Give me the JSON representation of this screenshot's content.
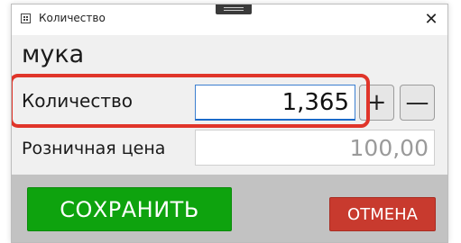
{
  "window": {
    "title": "Количество",
    "close_glyph": "✕",
    "app_icon": "calculator-icon"
  },
  "product": {
    "name": "мука"
  },
  "quantity": {
    "label": "Количество",
    "value": "1,365",
    "plus_label": "+",
    "minus_label": "—"
  },
  "price": {
    "label": "Розничная цена",
    "value": "100,00"
  },
  "actions": {
    "save_label": "СОХРАНИТЬ",
    "cancel_label": "ОТМЕНА"
  },
  "colors": {
    "save": "#0ea30e",
    "cancel": "#c83a2e",
    "highlight": "#e0352a",
    "input_focus": "#1b6ac9"
  }
}
